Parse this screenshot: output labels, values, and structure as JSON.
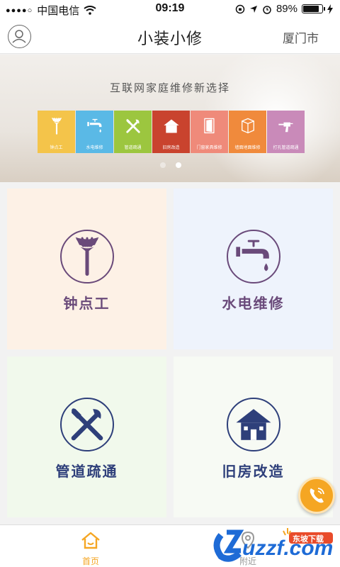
{
  "status_bar": {
    "signal_dots": "●●●●○",
    "carrier": "中国电信",
    "time": "09:19",
    "battery": "89%",
    "battery_level": 0.89
  },
  "header": {
    "title": "小装小修",
    "city": "厦门市"
  },
  "banner": {
    "slogan": "互联网家庭维修新选择",
    "tiles": [
      {
        "label": "钟点工",
        "color": "#f4c44a",
        "icon": "broom-icon"
      },
      {
        "label": "水电维修",
        "color": "#5ab9e6",
        "icon": "faucet-icon"
      },
      {
        "label": "管道疏通",
        "color": "#9cc63f",
        "icon": "tools-icon"
      },
      {
        "label": "旧房改造",
        "color": "#c9432e",
        "icon": "house-icon"
      },
      {
        "label": "门窗家具维修",
        "color": "#ef8a7a",
        "icon": "door-icon"
      },
      {
        "label": "墙面地面维修",
        "color": "#f08a3c",
        "icon": "wall-icon"
      },
      {
        "label": "打孔管道疏通",
        "color": "#c98ab9",
        "icon": "drill-icon"
      }
    ],
    "pages": 2,
    "active_page": 2
  },
  "services": [
    {
      "label": "钟点工",
      "icon": "broom-icon",
      "bg": "#fdf1e6",
      "accent": "#6a4a7a"
    },
    {
      "label": "水电维修",
      "icon": "faucet-icon",
      "bg": "#eef3fc",
      "accent": "#6a4a7a"
    },
    {
      "label": "管道疏通",
      "icon": "tools-icon",
      "bg": "#f1f9ec",
      "accent": "#2e3f7a"
    },
    {
      "label": "旧房改造",
      "icon": "house-icon",
      "bg": "#f7faf4",
      "accent": "#2e3f7a"
    }
  ],
  "tabbar": {
    "home": "首页",
    "nearby": "附近",
    "active_color": "#f5a623"
  },
  "watermark": {
    "logo_text": "uzzf.com",
    "badge_text": "东坡下载"
  }
}
